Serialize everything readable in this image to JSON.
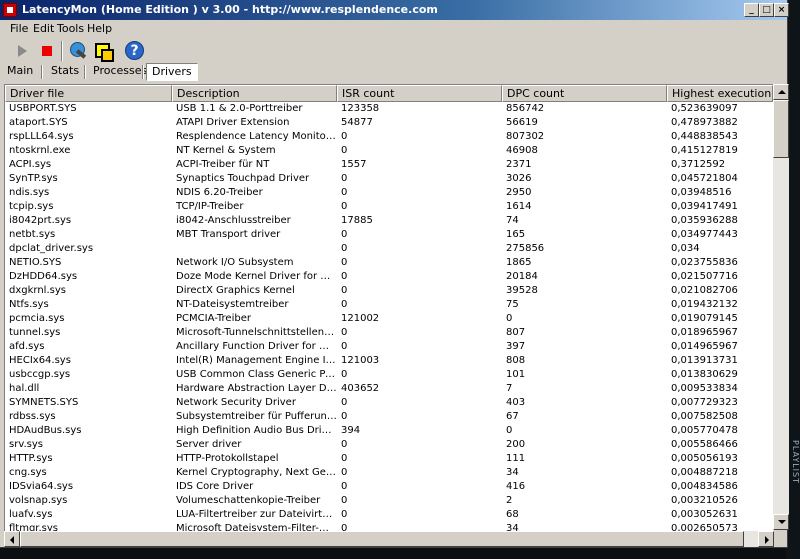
{
  "window": {
    "title": "LatencyMon  (Home Edition )  v 3.00 - http://www.resplendence.com"
  },
  "title_buttons": {
    "minimize": "_",
    "maximize": "□",
    "close": "×"
  },
  "menu": [
    "File",
    "Edit",
    "Tools",
    "Help"
  ],
  "toolbar": [
    "play-icon",
    "stop-icon",
    "cpu-icon",
    "windows-icon",
    "help-icon"
  ],
  "tabs": [
    {
      "label": "Main",
      "active": false
    },
    {
      "label": "Stats",
      "active": false
    },
    {
      "label": "Processes",
      "active": false
    },
    {
      "label": "Drivers",
      "active": true
    }
  ],
  "table": {
    "columns": [
      "Driver file",
      "Description",
      "ISR count",
      "DPC count",
      "Highest execution (ms)"
    ],
    "rows": [
      [
        "USBPORT.SYS",
        "USB 1.1 & 2.0-Porttreiber",
        "123358",
        "856742",
        "0,523639097"
      ],
      [
        "ataport.SYS",
        "ATAPI Driver Extension",
        "54877",
        "56619",
        "0,478973882"
      ],
      [
        "rspLLL64.sys",
        "Resplendence Latency Monitoring an...",
        "0",
        "807302",
        "0,448838543"
      ],
      [
        "ntoskrnl.exe",
        "NT Kernel & System",
        "0",
        "46908",
        "0,415127819"
      ],
      [
        "ACPI.sys",
        "ACPI-Treiber für NT",
        "1557",
        "2371",
        "0,3712592"
      ],
      [
        "SynTP.sys",
        "Synaptics Touchpad Driver",
        "0",
        "3026",
        "0,045721804"
      ],
      [
        "ndis.sys",
        "NDIS 6.20-Treiber",
        "0",
        "2950",
        "0,03948516"
      ],
      [
        "tcpip.sys",
        "TCP/IP-Treiber",
        "0",
        "1614",
        "0,039417491"
      ],
      [
        "i8042prt.sys",
        "i8042-Anschlusstreiber",
        "17885",
        "74",
        "0,035936288"
      ],
      [
        "netbt.sys",
        "MBT Transport driver",
        "0",
        "165",
        "0,034977443"
      ],
      [
        "dpclat_driver.sys",
        "",
        "0",
        "275856",
        "0,034"
      ],
      [
        "NETIO.SYS",
        "Network I/O Subsystem",
        "0",
        "1865",
        "0,023755836"
      ],
      [
        "DzHDD64.sys",
        "Doze Mode Kernel Driver for HDD co...",
        "0",
        "20184",
        "0,021507716"
      ],
      [
        "dxgkrnl.sys",
        "DirectX Graphics Kernel",
        "0",
        "39528",
        "0,021082706"
      ],
      [
        "Ntfs.sys",
        "NT-Dateisystemtreiber",
        "0",
        "75",
        "0,019432132"
      ],
      [
        "pcmcia.sys",
        "PCMCIA-Treiber",
        "121002",
        "0",
        "0,019079145"
      ],
      [
        "tunnel.sys",
        "Microsoft-Tunnelschnittstellentreiber",
        "0",
        "807",
        "0,018965967"
      ],
      [
        "afd.sys",
        "Ancillary Function Driver for WinSock",
        "0",
        "397",
        "0,014965967"
      ],
      [
        "HECIx64.sys",
        "Intel(R) Management Engine Interface",
        "121003",
        "808",
        "0,013913731"
      ],
      [
        "usbccgp.sys",
        "USB Common Class Generic Parent D...",
        "0",
        "101",
        "0,013830629"
      ],
      [
        "hal.dll",
        "Hardware Abstraction Layer DLL",
        "403652",
        "7",
        "0,009533834"
      ],
      [
        "SYMNETS.SYS",
        "Network Security Driver",
        "0",
        "403",
        "0,007729323"
      ],
      [
        "rdbss.sys",
        "Subsystemtreiber für Pufferung des ...",
        "0",
        "67",
        "0,007582508"
      ],
      [
        "HDAudBus.sys",
        "High Definition Audio Bus Driver",
        "394",
        "0",
        "0,005770478"
      ],
      [
        "srv.sys",
        "Server driver",
        "0",
        "200",
        "0,005586466"
      ],
      [
        "HTTP.sys",
        "HTTP-Protokollstapel",
        "0",
        "111",
        "0,005056193"
      ],
      [
        "cng.sys",
        "Kernel Cryptography, Next Generation",
        "0",
        "34",
        "0,004887218"
      ],
      [
        "IDSvia64.sys",
        "IDS Core Driver",
        "0",
        "416",
        "0,004834586"
      ],
      [
        "volsnap.sys",
        "Volumeschattenkopie-Treiber",
        "0",
        "2",
        "0,003210526"
      ],
      [
        "luafv.sys",
        "LUA-Filtertreiber zur Dateivirtualisier...",
        "0",
        "68",
        "0,003052631"
      ],
      [
        "fltmgr.sys",
        "Microsoft Dateisystem-Filter-Manager",
        "0",
        "34",
        "0,002650573"
      ]
    ]
  },
  "desktop_label": "PLAYLIST"
}
